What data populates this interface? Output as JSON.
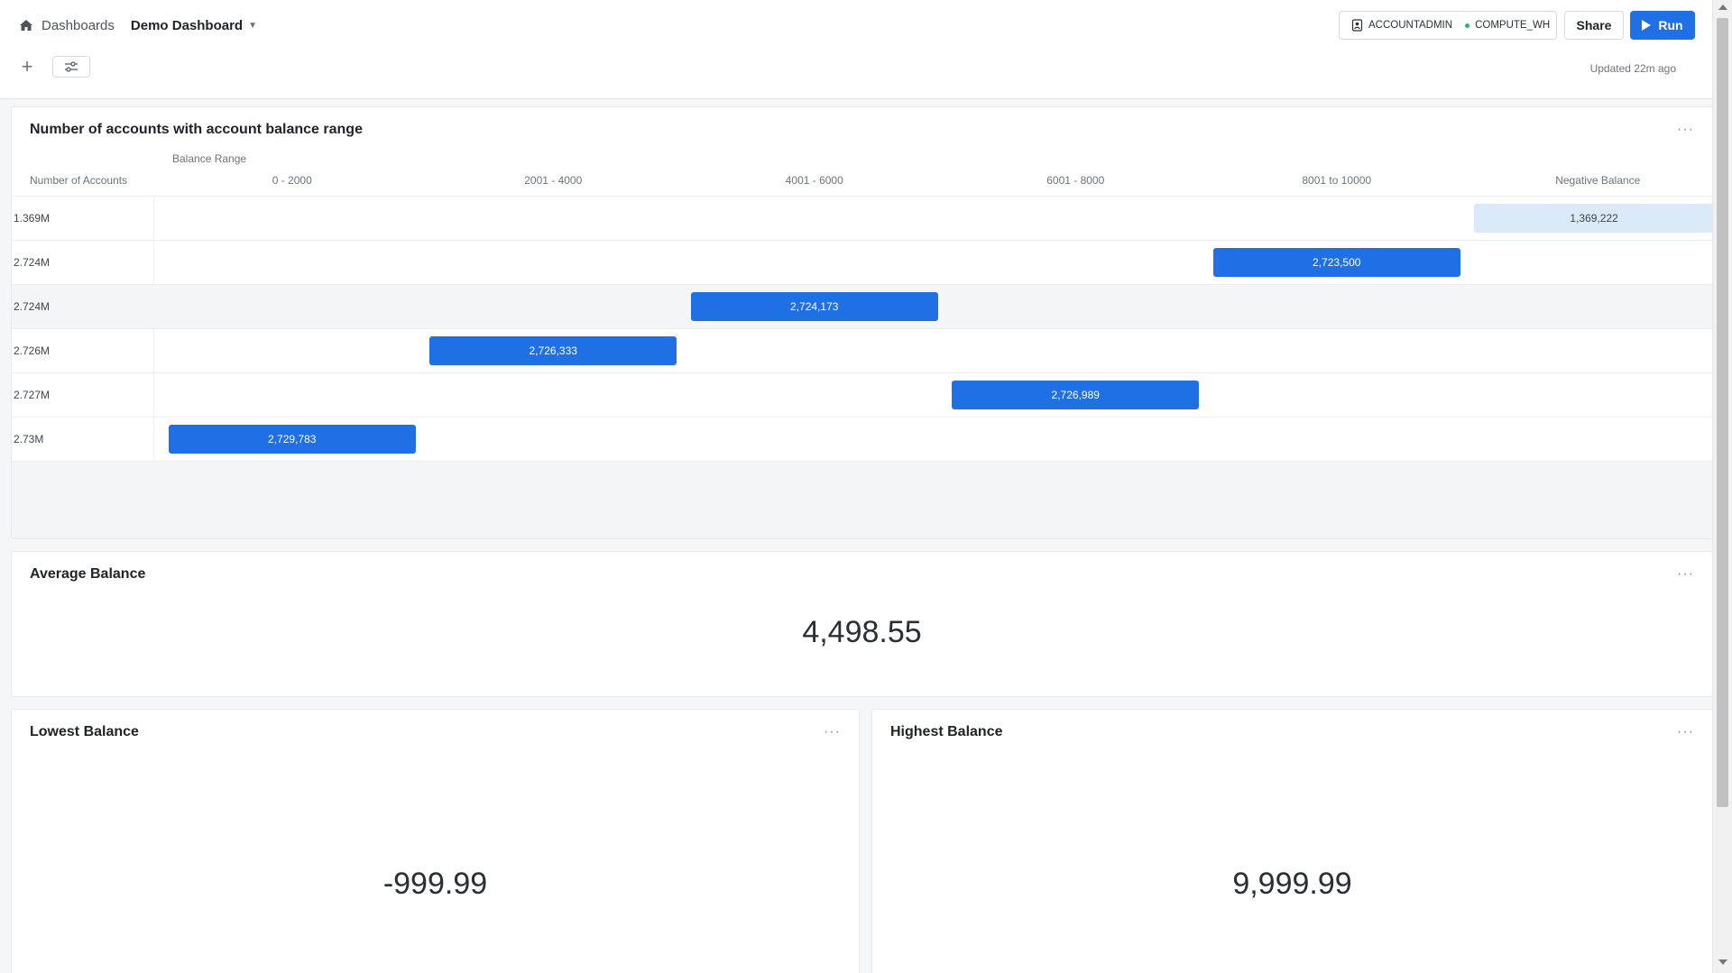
{
  "header": {
    "breadcrumb_link": "Dashboards",
    "dashboard_title": "Demo Dashboard",
    "role": "ACCOUNTADMIN",
    "warehouse": "COMPUTE_WH",
    "share_label": "Share",
    "run_label": "Run",
    "updated_text": "Updated 22m ago"
  },
  "colors": {
    "accent": "#1f6fe5",
    "bar_highlight": "#dbeaf9",
    "status_dot": "#2fb36a"
  },
  "chart_card": {
    "title": "Number of accounts with account balance range",
    "menu": "···"
  },
  "chart_data": {
    "type": "heatmap",
    "title": "Number of accounts with account balance range",
    "series_label": "Balance Range",
    "ylabel": "Number of Accounts",
    "columns": [
      "0 - 2000",
      "2001 - 4000",
      "4001 - 6000",
      "6001 - 8000",
      "8001 to 10000",
      "Negative Balance"
    ],
    "rows": [
      {
        "label": "1.369M",
        "column": "Negative Balance",
        "value": 1369222,
        "value_label": "1,369,222",
        "style": "light"
      },
      {
        "label": "2.724M",
        "column": "8001 to 10000",
        "value": 2723500,
        "value_label": "2,723,500",
        "style": "solid"
      },
      {
        "label": "2.724M",
        "column": "4001 - 6000",
        "value": 2724173,
        "value_label": "2,724,173",
        "style": "solid"
      },
      {
        "label": "2.726M",
        "column": "2001 - 4000",
        "value": 2726333,
        "value_label": "2,726,333",
        "style": "solid"
      },
      {
        "label": "2.727M",
        "column": "6001 - 8000",
        "value": 2726989,
        "value_label": "2,726,989",
        "style": "solid"
      },
      {
        "label": "2.73M",
        "column": "0 - 2000",
        "value": 2729783,
        "value_label": "2,729,783",
        "style": "solid"
      }
    ]
  },
  "avg_card": {
    "title": "Average Balance",
    "value": "4,498.55",
    "menu": "···"
  },
  "low_card": {
    "title": "Lowest Balance",
    "value": "-999.99",
    "menu": "···"
  },
  "high_card": {
    "title": "Highest Balance",
    "value": "9,999.99",
    "menu": "···"
  }
}
